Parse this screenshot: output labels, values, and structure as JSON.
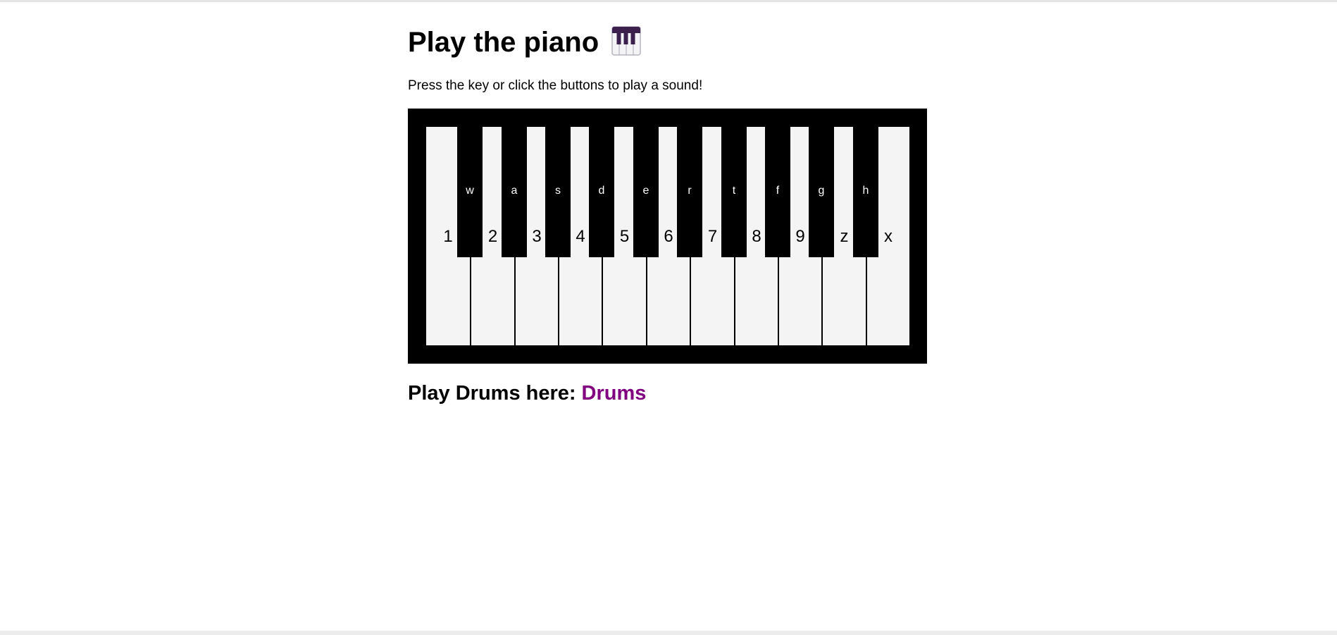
{
  "page": {
    "title": "Play the piano",
    "title_icon": "piano-keys-emoji",
    "subtitle": "Press the key or click the buttons to play a sound!"
  },
  "piano": {
    "white_keys": [
      "1",
      "2",
      "3",
      "4",
      "5",
      "6",
      "7",
      "8",
      "9",
      "z",
      "x"
    ],
    "black_keys": [
      "w",
      "a",
      "s",
      "d",
      "e",
      "r",
      "t",
      "f",
      "g",
      "h"
    ]
  },
  "drums": {
    "label": "Play Drums here:",
    "link_text": "Drums"
  },
  "colors": {
    "piano_frame": "#000000",
    "white_key": "#f4f4f4",
    "black_key": "#000000",
    "link": "#800080",
    "emoji_top": "#3b1f4d"
  }
}
